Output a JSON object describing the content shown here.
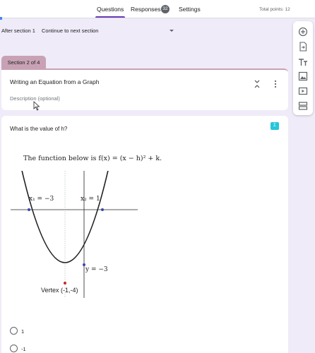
{
  "header": {
    "tabs": [
      {
        "label": "Questions"
      },
      {
        "label": "Responses"
      },
      {
        "label": "Settings"
      }
    ],
    "responses_count": "32",
    "total_points": "Total points: 12",
    "accent_color": "#673ab7"
  },
  "after_section": {
    "label": "After section 1",
    "value": "Continue to next section"
  },
  "section": {
    "tab_label": "Section 2 of 4",
    "title": "Writing an Equation from a Graph",
    "description_placeholder": "Description (optional)",
    "color": "#c8a2b4"
  },
  "question": {
    "text": "What is the value of h?",
    "image": {
      "function_text": "The function below is f(x) = (x − h)² + k.",
      "x1_label": "x₁ = −3",
      "x2_label": "x₂ = 1",
      "y_label": "y = −3",
      "vertex_label": "Vertex (-1,-4)"
    },
    "options": [
      {
        "label": "1"
      },
      {
        "label": "-1"
      }
    ]
  },
  "sidebar_icons": [
    "add-question-icon",
    "import-questions-icon",
    "add-title-icon",
    "add-image-icon",
    "add-video-icon",
    "add-section-icon"
  ]
}
